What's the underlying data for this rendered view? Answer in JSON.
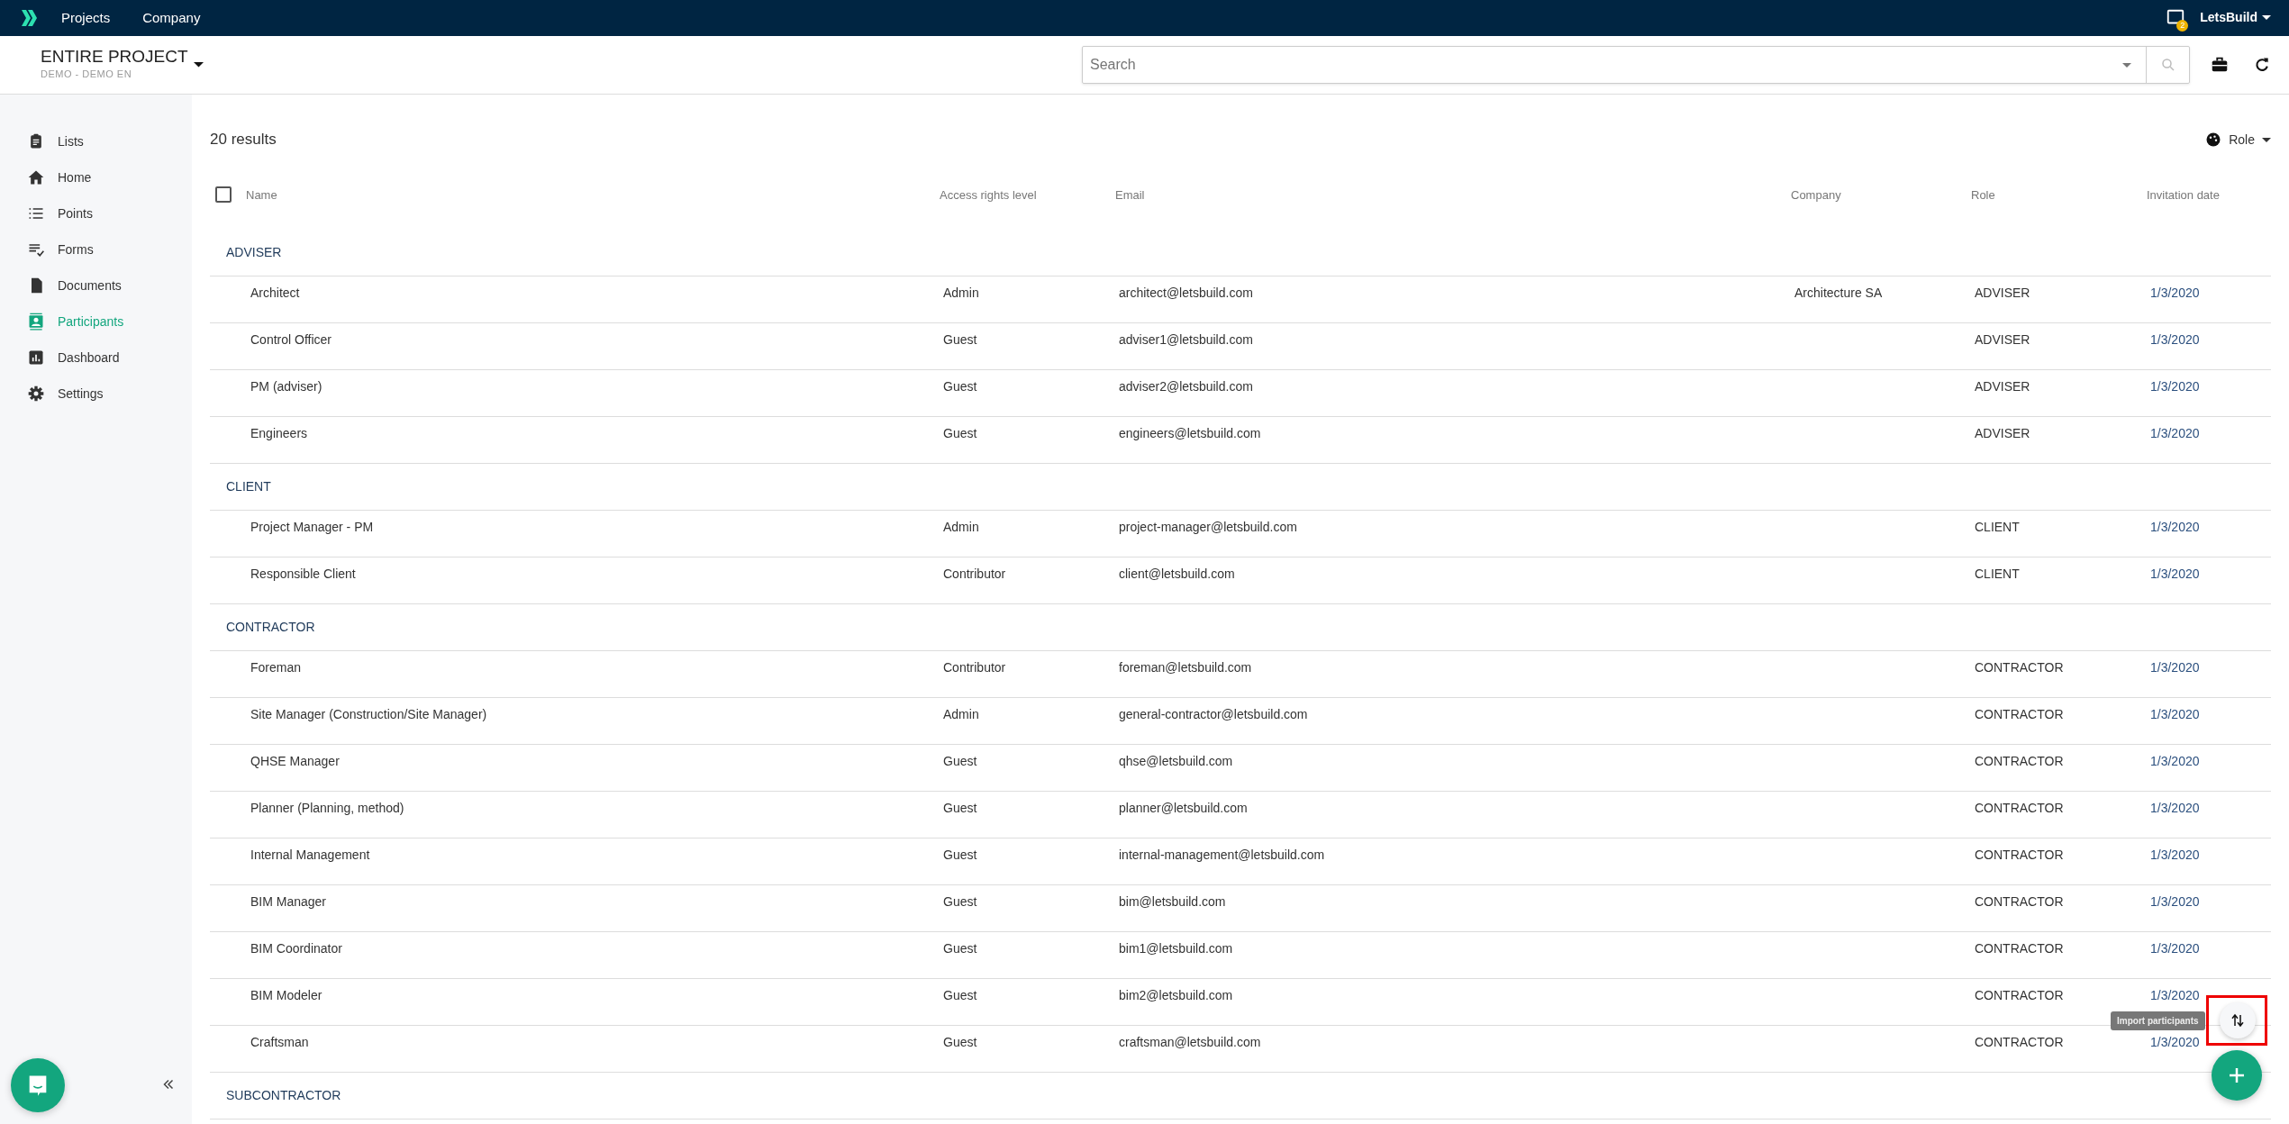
{
  "topbar": {
    "nav": [
      "Projects",
      "Company"
    ],
    "notification_count": "2",
    "account": "LetsBuild"
  },
  "project": {
    "title": "ENTIRE PROJECT",
    "subtitle": "DEMO - DEMO EN"
  },
  "search": {
    "placeholder": "Search"
  },
  "sidebar": {
    "items": [
      {
        "label": "Lists",
        "kind": "lists",
        "selected": false
      },
      {
        "label": "Home",
        "kind": "home",
        "selected": false
      },
      {
        "label": "Points",
        "kind": "points",
        "selected": false
      },
      {
        "label": "Forms",
        "kind": "forms",
        "selected": false
      },
      {
        "label": "Documents",
        "kind": "documents",
        "selected": false
      },
      {
        "label": "Participants",
        "kind": "participants",
        "selected": true
      },
      {
        "label": "Dashboard",
        "kind": "dashboard",
        "selected": false
      },
      {
        "label": "Settings",
        "kind": "settings",
        "selected": false
      }
    ]
  },
  "results": "20 results",
  "role_filter": "Role",
  "table": {
    "select_all_checked": false,
    "columns": [
      "Name",
      "Access rights level",
      "Email",
      "Company",
      "Role",
      "Invitation date"
    ],
    "groups": [
      {
        "name": "ADVISER",
        "rows": [
          {
            "name": "Architect",
            "access": "Admin",
            "email": "architect@letsbuild.com",
            "company": "Architecture SA",
            "role": "ADVISER",
            "date": "1/3/2020"
          },
          {
            "name": "Control Officer",
            "access": "Guest",
            "email": "adviser1@letsbuild.com",
            "role": "ADVISER",
            "date": "1/3/2020"
          },
          {
            "name": "PM (adviser)",
            "access": "Guest",
            "email": "adviser2@letsbuild.com",
            "role": "ADVISER",
            "date": "1/3/2020"
          },
          {
            "name": "Engineers",
            "access": "Guest",
            "email": "engineers@letsbuild.com",
            "role": "ADVISER",
            "date": "1/3/2020"
          }
        ]
      },
      {
        "name": "CLIENT",
        "rows": [
          {
            "name": "Project Manager - PM",
            "access": "Admin",
            "email": "project-manager@letsbuild.com",
            "role": "CLIENT",
            "date": "1/3/2020"
          },
          {
            "name": "Responsible Client",
            "access": "Contributor",
            "email": "client@letsbuild.com",
            "role": "CLIENT",
            "date": "1/3/2020"
          }
        ]
      },
      {
        "name": "CONTRACTOR",
        "rows": [
          {
            "name": "Foreman",
            "access": "Contributor",
            "email": "foreman@letsbuild.com",
            "role": "CONTRACTOR",
            "date": "1/3/2020"
          },
          {
            "name": "Site Manager (Construction/Site Manager)",
            "access": "Admin",
            "email": "general-contractor@letsbuild.com",
            "role": "CONTRACTOR",
            "date": "1/3/2020"
          },
          {
            "name": "QHSE Manager",
            "access": "Guest",
            "email": "qhse@letsbuild.com",
            "role": "CONTRACTOR",
            "date": "1/3/2020"
          },
          {
            "name": "Planner (Planning, method)",
            "access": "Guest",
            "email": "planner@letsbuild.com",
            "role": "CONTRACTOR",
            "date": "1/3/2020"
          },
          {
            "name": "Internal Management",
            "access": "Guest",
            "email": "internal-management@letsbuild.com",
            "role": "CONTRACTOR",
            "date": "1/3/2020"
          },
          {
            "name": "BIM Manager",
            "access": "Guest",
            "email": "bim@letsbuild.com",
            "role": "CONTRACTOR",
            "date": "1/3/2020"
          },
          {
            "name": "BIM Coordinator",
            "access": "Guest",
            "email": "bim1@letsbuild.com",
            "role": "CONTRACTOR",
            "date": "1/3/2020"
          },
          {
            "name": "BIM Modeler",
            "access": "Guest",
            "email": "bim2@letsbuild.com",
            "role": "CONTRACTOR",
            "date": "1/3/2020"
          },
          {
            "name": "Craftsman",
            "access": "Guest",
            "email": "craftsman@letsbuild.com",
            "role": "CONTRACTOR",
            "date": "1/3/2020"
          }
        ]
      },
      {
        "name": "SUBCONTRACTOR"
      }
    ]
  },
  "import_tooltip": "Import participants"
}
